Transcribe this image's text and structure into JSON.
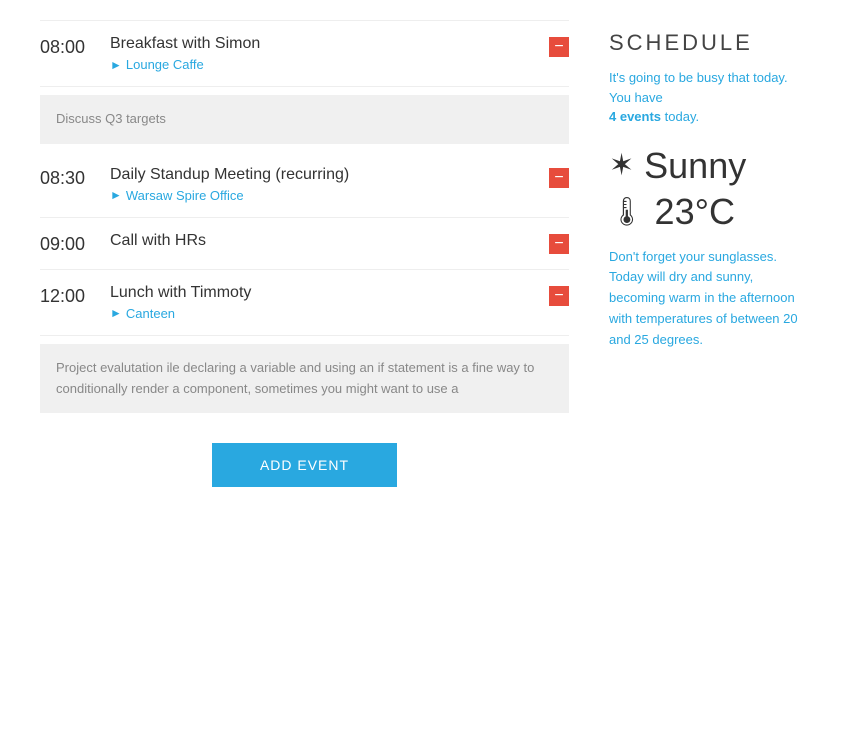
{
  "schedule": {
    "title": "SCHEDULE",
    "intro_line1": "It's going to be busy that today. You have",
    "event_count": "4 events",
    "intro_line2": "today."
  },
  "weather": {
    "condition": "Sunny",
    "temperature": "23°C",
    "sun_icon": "✦",
    "thermo_icon": "🌡",
    "description": "Don't forget your sunglasses. Today will dry and sunny, becoming warm in the afternoon with temperatures of between 20 and 25 degrees."
  },
  "events": [
    {
      "time": "08:00",
      "title": "Breakfast with Simon",
      "location": "Lounge Caffe",
      "has_note": true,
      "note": "Discuss Q3 targets"
    },
    {
      "time": "08:30",
      "title": "Daily Standup Meeting (recurring)",
      "location": "Warsaw Spire Office",
      "has_note": false,
      "note": ""
    },
    {
      "time": "09:00",
      "title": "Call with HRs",
      "location": "",
      "has_note": false,
      "note": ""
    },
    {
      "time": "12:00",
      "title": "Lunch with Timmoty",
      "location": "Canteen",
      "has_note": true,
      "note": "Project evalutation ile declaring a variable and using an if statement is a fine way to conditionally render a component, sometimes you might want to use a"
    }
  ],
  "buttons": {
    "add_event": "ADD EVENT",
    "delete": "−"
  }
}
